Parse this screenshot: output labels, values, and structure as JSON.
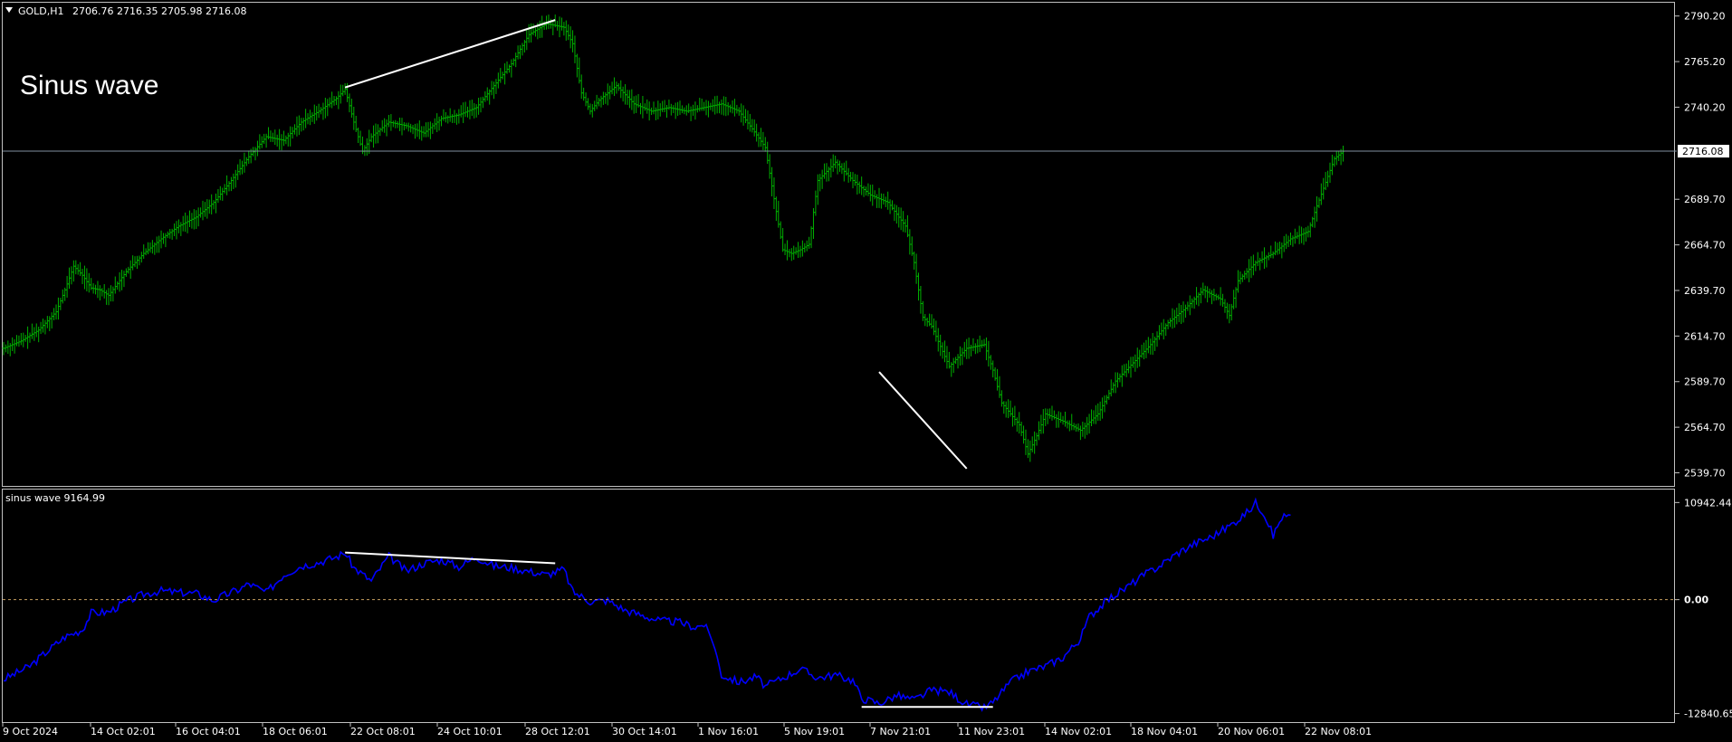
{
  "header": {
    "symbol": "GOLD,H1",
    "ohlc": "2706.76 2716.35 2705.98 2716.08",
    "overlay_title": "Sinus wave"
  },
  "indicator": {
    "label": "sinus wave 9164.99"
  },
  "colors": {
    "background": "#000000",
    "candle": "#00b000",
    "indicator_line": "#0000ff",
    "trendline": "#ffffff",
    "frame": "#c0c0c0",
    "zero_line": "#c8a060",
    "price_line": "#8090a0"
  },
  "chart_data": [
    {
      "type": "line",
      "series_kind": "candlestick-bars",
      "y_ticks": [
        "2790.20",
        "2765.20",
        "2740.20",
        "2689.70",
        "2664.70",
        "2639.70",
        "2614.70",
        "2589.70",
        "2564.70",
        "2539.70"
      ],
      "current_price": "2716.08",
      "ylim": [
        2534,
        2796
      ],
      "x_ticks": [
        "9 Oct 2024",
        "14 Oct 02:01",
        "16 Oct 04:01",
        "18 Oct 06:01",
        "22 Oct 08:01",
        "24 Oct 10:01",
        "28 Oct 12:01",
        "30 Oct 14:01",
        "1 Nov 16:01",
        "5 Nov 19:01",
        "7 Nov 21:01",
        "11 Nov 23:01",
        "14 Nov 02:01",
        "18 Nov 04:01",
        "20 Nov 06:01",
        "22 Nov 08:01"
      ],
      "approx_close_path": [
        [
          0,
          2608
        ],
        [
          2,
          2612
        ],
        [
          4,
          2618
        ],
        [
          6,
          2628
        ],
        [
          7,
          2640
        ],
        [
          8,
          2653
        ],
        [
          9,
          2648
        ],
        [
          10,
          2641
        ],
        [
          11,
          2640
        ],
        [
          12,
          2637
        ],
        [
          14,
          2650
        ],
        [
          16,
          2660
        ],
        [
          18,
          2668
        ],
        [
          20,
          2675
        ],
        [
          22,
          2680
        ],
        [
          24,
          2688
        ],
        [
          26,
          2700
        ],
        [
          28,
          2713
        ],
        [
          30,
          2724
        ],
        [
          32,
          2722
        ],
        [
          34,
          2732
        ],
        [
          36,
          2738
        ],
        [
          38,
          2745
        ],
        [
          39,
          2750
        ],
        [
          40,
          2732
        ],
        [
          41,
          2716
        ],
        [
          42,
          2724
        ],
        [
          44,
          2732
        ],
        [
          46,
          2730
        ],
        [
          48,
          2726
        ],
        [
          50,
          2734
        ],
        [
          52,
          2736
        ],
        [
          54,
          2740
        ],
        [
          56,
          2752
        ],
        [
          58,
          2764
        ],
        [
          60,
          2780
        ],
        [
          62,
          2786
        ],
        [
          64,
          2784
        ],
        [
          65,
          2775
        ],
        [
          66,
          2748
        ],
        [
          67,
          2738
        ],
        [
          68,
          2744
        ],
        [
          70,
          2752
        ],
        [
          72,
          2742
        ],
        [
          74,
          2738
        ],
        [
          76,
          2740
        ],
        [
          78,
          2738
        ],
        [
          80,
          2740
        ],
        [
          82,
          2742
        ],
        [
          84,
          2738
        ],
        [
          86,
          2725
        ],
        [
          87,
          2718
        ],
        [
          88,
          2690
        ],
        [
          89,
          2662
        ],
        [
          90,
          2660
        ],
        [
          91,
          2662
        ],
        [
          92,
          2665
        ],
        [
          93,
          2700
        ],
        [
          95,
          2710
        ],
        [
          97,
          2700
        ],
        [
          99,
          2692
        ],
        [
          101,
          2688
        ],
        [
          103,
          2675
        ],
        [
          104,
          2655
        ],
        [
          105,
          2625
        ],
        [
          106,
          2620
        ],
        [
          108,
          2598
        ],
        [
          110,
          2608
        ],
        [
          112,
          2610
        ],
        [
          113,
          2596
        ],
        [
          114,
          2578
        ],
        [
          116,
          2566
        ],
        [
          117,
          2550
        ],
        [
          118,
          2560
        ],
        [
          119,
          2572
        ],
        [
          121,
          2568
        ],
        [
          123,
          2563
        ],
        [
          125,
          2572
        ],
        [
          127,
          2590
        ],
        [
          129,
          2600
        ],
        [
          131,
          2610
        ],
        [
          133,
          2622
        ],
        [
          135,
          2630
        ],
        [
          137,
          2640
        ],
        [
          139,
          2635
        ],
        [
          140,
          2626
        ],
        [
          141,
          2645
        ],
        [
          143,
          2655
        ],
        [
          145,
          2660
        ],
        [
          147,
          2668
        ],
        [
          149,
          2672
        ],
        [
          150,
          2686
        ],
        [
          152,
          2712
        ],
        [
          153,
          2716
        ]
      ],
      "trendlines": [
        {
          "from": [
            39,
            2751
          ],
          "to": [
            63,
            2788
          ]
        },
        {
          "from": [
            100,
            2595
          ],
          "to": [
            110,
            2542
          ]
        }
      ]
    },
    {
      "type": "line",
      "name": "sinus wave",
      "y_ticks": [
        "10942.44",
        "0.00",
        "-12840.65"
      ],
      "ylim": [
        -13600,
        12100
      ],
      "approx_path": [
        [
          0,
          -9000
        ],
        [
          3,
          -7500
        ],
        [
          5,
          -5800
        ],
        [
          7,
          -4200
        ],
        [
          9,
          -3400
        ],
        [
          10,
          -1500
        ],
        [
          12,
          -1400
        ],
        [
          14,
          -200
        ],
        [
          16,
          600
        ],
        [
          18,
          1000
        ],
        [
          20,
          800
        ],
        [
          22,
          700
        ],
        [
          24,
          -100
        ],
        [
          25,
          400
        ],
        [
          27,
          1200
        ],
        [
          28,
          1800
        ],
        [
          30,
          800
        ],
        [
          32,
          2800
        ],
        [
          34,
          3800
        ],
        [
          36,
          4200
        ],
        [
          38,
          4800
        ],
        [
          39,
          5300
        ],
        [
          40,
          3600
        ],
        [
          42,
          2100
        ],
        [
          44,
          4900
        ],
        [
          46,
          3200
        ],
        [
          48,
          4100
        ],
        [
          50,
          4500
        ],
        [
          52,
          3700
        ],
        [
          54,
          4800
        ],
        [
          56,
          3800
        ],
        [
          58,
          3600
        ],
        [
          60,
          3200
        ],
        [
          62,
          2800
        ],
        [
          64,
          3400
        ],
        [
          65,
          900
        ],
        [
          67,
          -200
        ],
        [
          69,
          -100
        ],
        [
          71,
          -1200
        ],
        [
          73,
          -1800
        ],
        [
          75,
          -2400
        ],
        [
          77,
          -2500
        ],
        [
          79,
          -3100
        ],
        [
          80,
          -2800
        ],
        [
          81,
          -4600
        ],
        [
          82,
          -8500
        ],
        [
          84,
          -9300
        ],
        [
          86,
          -8700
        ],
        [
          87,
          -9800
        ],
        [
          89,
          -8800
        ],
        [
          91,
          -7800
        ],
        [
          93,
          -8800
        ],
        [
          95,
          -8500
        ],
        [
          97,
          -9100
        ],
        [
          98,
          -11100
        ],
        [
          100,
          -11700
        ],
        [
          102,
          -10800
        ],
        [
          104,
          -11300
        ],
        [
          106,
          -10200
        ],
        [
          108,
          -10400
        ],
        [
          110,
          -11800
        ],
        [
          112,
          -12200
        ],
        [
          113,
          -11600
        ],
        [
          115,
          -9300
        ],
        [
          117,
          -8100
        ],
        [
          119,
          -7500
        ],
        [
          121,
          -6500
        ],
        [
          123,
          -4400
        ],
        [
          124,
          -1900
        ],
        [
          126,
          -100
        ],
        [
          128,
          1200
        ],
        [
          130,
          2600
        ],
        [
          132,
          3800
        ],
        [
          134,
          5200
        ],
        [
          136,
          6300
        ],
        [
          138,
          7100
        ],
        [
          140,
          8300
        ],
        [
          142,
          9800
        ],
        [
          143,
          10900
        ],
        [
          144,
          9700
        ],
        [
          145,
          7200
        ],
        [
          146,
          9300
        ],
        [
          147,
          9400
        ]
      ],
      "trendlines": [
        {
          "from": [
            39,
            5300
          ],
          "to": [
            63,
            4100
          ]
        },
        {
          "from": [
            98,
            -12100
          ],
          "to": [
            113,
            -12100
          ]
        }
      ]
    }
  ]
}
